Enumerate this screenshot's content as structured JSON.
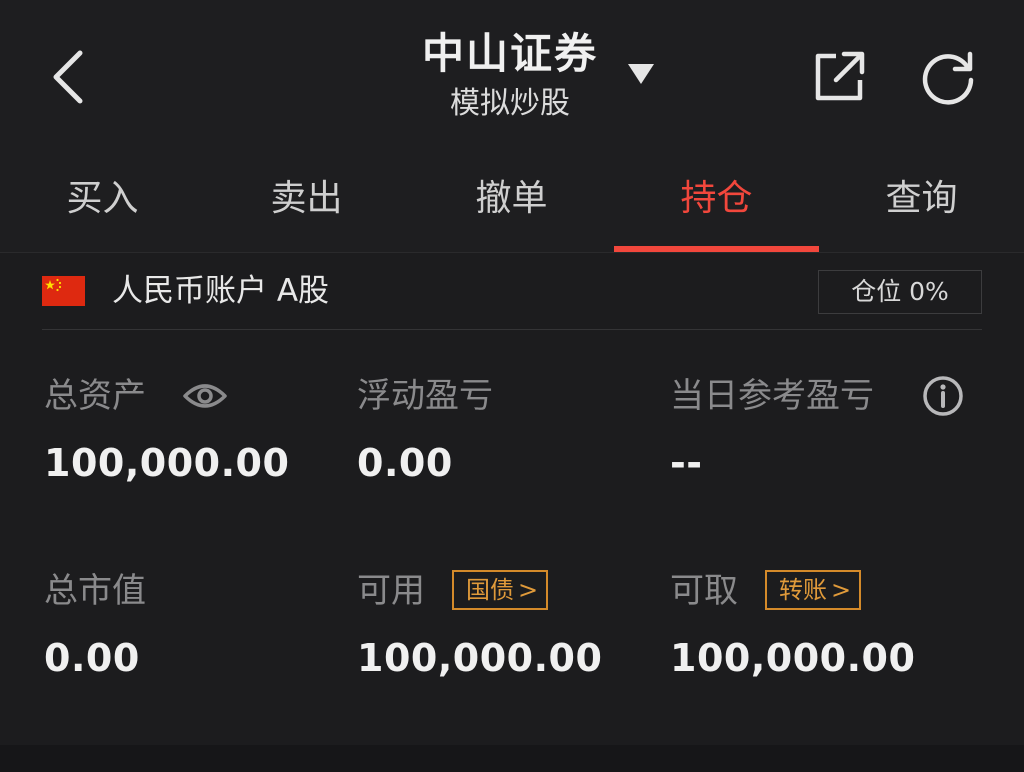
{
  "header": {
    "title": "中山证券",
    "subtitle": "模拟炒股"
  },
  "tabs": [
    {
      "label": "买入"
    },
    {
      "label": "卖出"
    },
    {
      "label": "撤单"
    },
    {
      "label": "持仓",
      "active": true
    },
    {
      "label": "查询"
    }
  ],
  "account": {
    "label": "人民币账户 A股",
    "position_badge": "仓位 0%"
  },
  "stats": {
    "total_assets_label": "总资产",
    "total_assets_value": "100,000.00",
    "floating_pl_label": "浮动盈亏",
    "floating_pl_value": "0.00",
    "daily_pl_label": "当日参考盈亏",
    "daily_pl_value": "--",
    "market_value_label": "总市值",
    "market_value_value": "0.00",
    "available_label": "可用",
    "available_tag": "国债",
    "available_value": "100,000.00",
    "withdrawable_label": "可取",
    "withdrawable_tag": "转账",
    "withdrawable_value": "100,000.00"
  },
  "colors": {
    "accent": "#f2473c",
    "tag": "#d48a2a",
    "background": "#1c1c1e"
  }
}
